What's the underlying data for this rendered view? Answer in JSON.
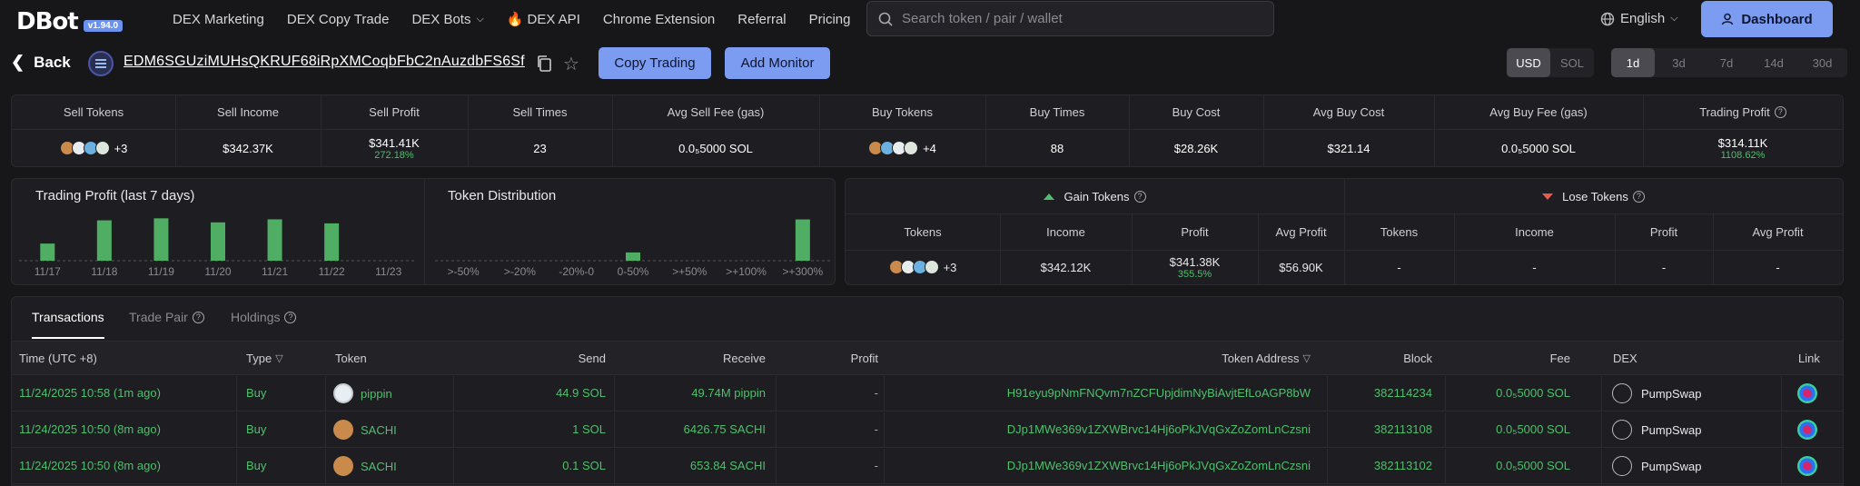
{
  "brand": {
    "logo": "DBot",
    "version": "v1.94.0"
  },
  "nav": {
    "items": [
      "DEX Marketing",
      "DEX Copy Trade",
      "DEX Bots",
      "DEX API",
      "Chrome Extension",
      "Referral",
      "Pricing"
    ],
    "search_placeholder": "Search token / pair / wallet",
    "language": "English",
    "dashboard": "Dashboard"
  },
  "wallet": {
    "back": "Back",
    "address": "EDM6SGUziMUHsQKRUF68iRpXMCoqbFbC2nAuzdbFS6Sf",
    "copy_trading": "Copy Trading",
    "add_monitor": "Add Monitor",
    "currency": [
      "USD",
      "SOL"
    ],
    "currency_active": "USD",
    "periods": [
      "1d",
      "3d",
      "7d",
      "14d",
      "30d"
    ],
    "period_active": "1d"
  },
  "stats": {
    "headers": [
      "Sell Tokens",
      "Sell Income",
      "Sell Profit",
      "Sell Times",
      "Avg Sell Fee (gas)",
      "Buy Tokens",
      "Buy Times",
      "Buy Cost",
      "Avg Buy Cost",
      "Avg Buy Fee (gas)",
      "Trading Profit"
    ],
    "sell_tokens_more": "+3",
    "sell_income": "$342.37K",
    "sell_profit": "$341.41K",
    "sell_profit_pct": "272.18%",
    "sell_times": "23",
    "avg_sell_fee": "0.0₅5000 SOL",
    "buy_tokens_more": "+4",
    "buy_times": "88",
    "buy_cost": "$28.26K",
    "avg_buy_cost": "$321.14",
    "avg_buy_fee": "0.0₅5000 SOL",
    "trading_profit": "$314.11K",
    "trading_profit_pct": "1108.62%"
  },
  "profit_chart": {
    "title": "Trading Profit (last 7 days)",
    "chart_data": {
      "type": "bar",
      "categories": [
        "11/17",
        "11/18",
        "11/19",
        "11/20",
        "11/21",
        "11/22",
        "11/23"
      ],
      "values": [
        17,
        40,
        42,
        38,
        41,
        37,
        0
      ],
      "ylim": [
        0,
        45
      ]
    }
  },
  "dist_chart": {
    "title": "Token Distribution",
    "chart_data": {
      "type": "bar",
      "categories": [
        ">-50%",
        ">-20%",
        "-20%-0",
        "0-50%",
        ">+50%",
        ">+100%",
        ">+300%"
      ],
      "values": [
        0,
        0,
        0,
        1,
        0,
        0,
        5
      ],
      "ylim": [
        0,
        5.5
      ]
    }
  },
  "gain_lose": {
    "gain_title": "Gain Tokens",
    "lose_title": "Lose Tokens",
    "headers": [
      "Tokens",
      "Income",
      "Profit",
      "Avg Profit",
      "Tokens",
      "Income",
      "Profit",
      "Avg Profit"
    ],
    "gain": {
      "more": "+3",
      "income": "$342.12K",
      "profit": "$341.38K",
      "profit_pct": "355.5%",
      "avg_profit": "$56.90K"
    },
    "lose": {
      "tokens": "-",
      "income": "-",
      "profit": "-",
      "avg_profit": "-"
    }
  },
  "tabs": [
    "Transactions",
    "Trade Pair",
    "Holdings"
  ],
  "tx": {
    "headers": [
      "Time (UTC +8)",
      "Type",
      "Token",
      "Send",
      "Receive",
      "Profit",
      "Token Address",
      "Block",
      "Fee",
      "DEX",
      "Link"
    ],
    "rows": [
      {
        "time": "11/24/2025 10:58",
        "ago": "(1m ago)",
        "type": "Buy",
        "token": "pippin",
        "send": "44.9 SOL",
        "receive": "49.74M pippin",
        "profit": "-",
        "address": "H91eyu9pNmFNQvm7nZCFUpjdimNyBiAvjtEfLoAGP8bW",
        "block": "382114234",
        "fee": "0.0₅5000 SOL",
        "dex": "PumpSwap"
      },
      {
        "time": "11/24/2025 10:50",
        "ago": "(8m ago)",
        "type": "Buy",
        "token": "SACHI",
        "send": "1 SOL",
        "receive": "6426.75 SACHI",
        "profit": "-",
        "address": "DJp1MWe369v1ZXWBrvc14Hj6oPkJVqGxZoZomLnCzsni",
        "block": "382113108",
        "fee": "0.0₅5000 SOL",
        "dex": "PumpSwap"
      },
      {
        "time": "11/24/2025 10:50",
        "ago": "(8m ago)",
        "type": "Buy",
        "token": "SACHI",
        "send": "0.1 SOL",
        "receive": "653.84 SACHI",
        "profit": "-",
        "address": "DJp1MWe369v1ZXWBrvc14Hj6oPkJVqGxZoZomLnCzsni",
        "block": "382113102",
        "fee": "0.0₅5000 SOL",
        "dex": "PumpSwap"
      }
    ]
  },
  "colors": {
    "accent": "#7b9cf0",
    "green": "#4fbf6d",
    "red": "#e85a4f",
    "bar": "#4fae63"
  }
}
